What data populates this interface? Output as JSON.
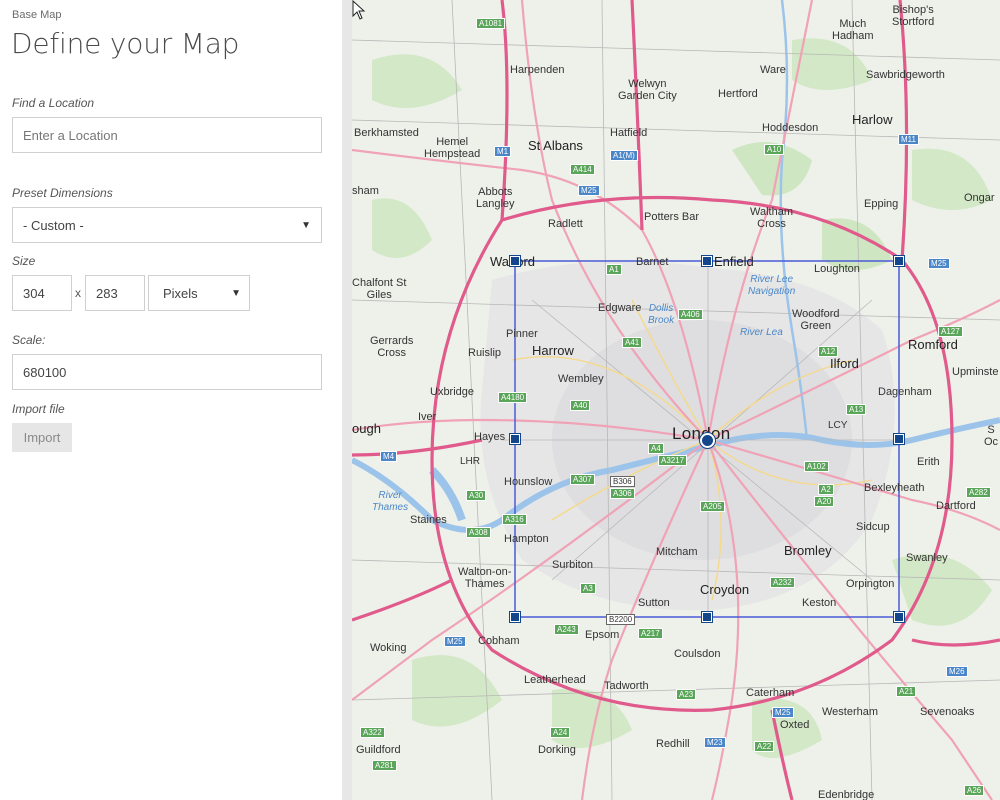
{
  "panel": {
    "breadcrumb": "Base Map",
    "title": "Define your Map",
    "find_location": {
      "label": "Find a Location",
      "placeholder": "Enter a Location",
      "value": ""
    },
    "preset": {
      "label": "Preset Dimensions",
      "selected": "- Custom -"
    },
    "size": {
      "label": "Size",
      "width": "304",
      "height": "283",
      "times": "x",
      "unit": "Pixels"
    },
    "scale": {
      "label": "Scale:",
      "value": "680100"
    },
    "import": {
      "label": "Import file",
      "button": "Import"
    }
  },
  "map": {
    "places": [
      {
        "name": "Much\nHadham"
      },
      {
        "name": "Bishop's\nStortford"
      },
      {
        "name": "Harpenden"
      },
      {
        "name": "Welwyn\nGarden City"
      },
      {
        "name": "Ware"
      },
      {
        "name": "Hertford"
      },
      {
        "name": "Sawbridgeworth"
      },
      {
        "name": "Berkhamsted"
      },
      {
        "name": "Hemel\nHempstead"
      },
      {
        "name": "St Albans"
      },
      {
        "name": "Hatfield"
      },
      {
        "name": "Hoddesdon"
      },
      {
        "name": "Harlow"
      },
      {
        "name": "sham"
      },
      {
        "name": "Abbots\nLangley"
      },
      {
        "name": "Radlett"
      },
      {
        "name": "Potters Bar"
      },
      {
        "name": "Waltham\nCross"
      },
      {
        "name": "Epping"
      },
      {
        "name": "Ongar"
      },
      {
        "name": "Watford"
      },
      {
        "name": "Barnet"
      },
      {
        "name": "Enfield"
      },
      {
        "name": "Loughton"
      },
      {
        "name": "Chalfont St\nGiles"
      },
      {
        "name": "Edgware"
      },
      {
        "name": "Woodford\nGreen"
      },
      {
        "name": "Pinner"
      },
      {
        "name": "Gerrards\nCross"
      },
      {
        "name": "Ruislip"
      },
      {
        "name": "Harrow"
      },
      {
        "name": "Romford"
      },
      {
        "name": "Ilford"
      },
      {
        "name": "Wembley"
      },
      {
        "name": "Upminste"
      },
      {
        "name": "Uxbridge"
      },
      {
        "name": "Dagenham"
      },
      {
        "name": "Iver"
      },
      {
        "name": "ough"
      },
      {
        "name": "Hayes"
      },
      {
        "name": "London"
      },
      {
        "name": "Erith"
      },
      {
        "name": "Hounslow"
      },
      {
        "name": "Bexleyheath"
      },
      {
        "name": "Dartford"
      },
      {
        "name": "Staines"
      },
      {
        "name": "Sidcup"
      },
      {
        "name": "Hampton"
      },
      {
        "name": "Surbiton"
      },
      {
        "name": "Mitcham"
      },
      {
        "name": "Bromley"
      },
      {
        "name": "Swanley"
      },
      {
        "name": "Walton-on-\nThames"
      },
      {
        "name": "Croydon"
      },
      {
        "name": "Orpington"
      },
      {
        "name": "Sutton"
      },
      {
        "name": "Keston"
      },
      {
        "name": "Cobham"
      },
      {
        "name": "Epsom"
      },
      {
        "name": "Woking"
      },
      {
        "name": "Coulsdon"
      },
      {
        "name": "Leatherhead"
      },
      {
        "name": "Tadworth"
      },
      {
        "name": "Caterham"
      },
      {
        "name": "Westerham"
      },
      {
        "name": "Sevenoaks"
      },
      {
        "name": "Oxted"
      },
      {
        "name": "Guildford"
      },
      {
        "name": "Dorking"
      },
      {
        "name": "Redhill"
      },
      {
        "name": "Edenbridge"
      },
      {
        "name": "LHR"
      },
      {
        "name": "LCY"
      },
      {
        "name": "S\nOc"
      }
    ],
    "water_labels": [
      {
        "name": "River Lee\nNavigation"
      },
      {
        "name": "Dollis\nBrook"
      },
      {
        "name": "River Lea"
      },
      {
        "name": "River\nThames"
      }
    ],
    "road_shields": [
      {
        "label": "A1081",
        "kind": "a"
      },
      {
        "label": "M1",
        "kind": "m"
      },
      {
        "label": "A414",
        "kind": "a"
      },
      {
        "label": "A1(M)",
        "kind": "m"
      },
      {
        "label": "M25",
        "kind": "m"
      },
      {
        "label": "A10",
        "kind": "a"
      },
      {
        "label": "M11",
        "kind": "m"
      },
      {
        "label": "A1",
        "kind": "a"
      },
      {
        "label": "A406",
        "kind": "a"
      },
      {
        "label": "M25",
        "kind": "m"
      },
      {
        "label": "A127",
        "kind": "a"
      },
      {
        "label": "A41",
        "kind": "a"
      },
      {
        "label": "A12",
        "kind": "a"
      },
      {
        "label": "A4180",
        "kind": "a"
      },
      {
        "label": "A40",
        "kind": "a"
      },
      {
        "label": "A13",
        "kind": "a"
      },
      {
        "label": "M4",
        "kind": "m"
      },
      {
        "label": "A4",
        "kind": "a"
      },
      {
        "label": "A3217",
        "kind": "a"
      },
      {
        "label": "A102",
        "kind": "a"
      },
      {
        "label": "A30",
        "kind": "a"
      },
      {
        "label": "A307",
        "kind": "a"
      },
      {
        "label": "B306",
        "kind": "b"
      },
      {
        "label": "A306",
        "kind": "a"
      },
      {
        "label": "A2",
        "kind": "a"
      },
      {
        "label": "A282",
        "kind": "a"
      },
      {
        "label": "A20",
        "kind": "a"
      },
      {
        "label": "A205",
        "kind": "a"
      },
      {
        "label": "A316",
        "kind": "a"
      },
      {
        "label": "A308",
        "kind": "a"
      },
      {
        "label": "A3",
        "kind": "a"
      },
      {
        "label": "A232",
        "kind": "a"
      },
      {
        "label": "B2200",
        "kind": "b"
      },
      {
        "label": "A243",
        "kind": "a"
      },
      {
        "label": "A217",
        "kind": "a"
      },
      {
        "label": "M25",
        "kind": "m"
      },
      {
        "label": "M26",
        "kind": "m"
      },
      {
        "label": "A23",
        "kind": "a"
      },
      {
        "label": "A21",
        "kind": "a"
      },
      {
        "label": "M25",
        "kind": "m"
      },
      {
        "label": "A322",
        "kind": "a"
      },
      {
        "label": "M23",
        "kind": "m"
      },
      {
        "label": "A22",
        "kind": "a"
      },
      {
        "label": "A281",
        "kind": "a"
      },
      {
        "label": "A24",
        "kind": "a"
      },
      {
        "label": "A26",
        "kind": "a"
      }
    ],
    "colors": {
      "selection": "#4a5bd6",
      "handle": "#13468a",
      "motorway": "#e05a8c",
      "primary": "#f0a2b6"
    }
  }
}
